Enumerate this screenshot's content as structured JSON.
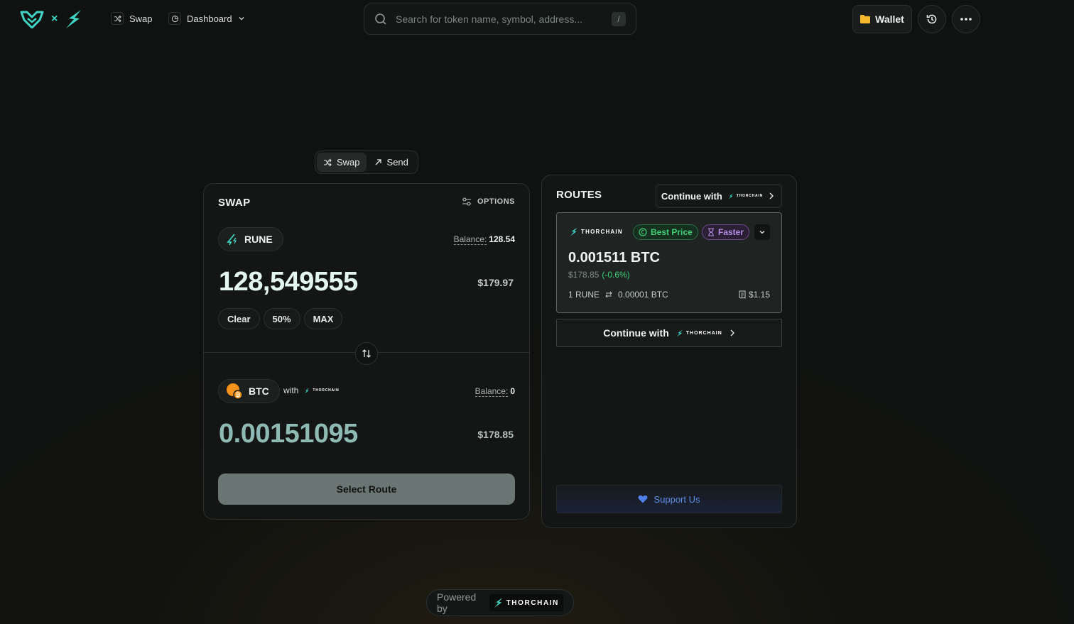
{
  "header": {
    "logo_separator": "×",
    "nav": [
      {
        "label": "Swap"
      },
      {
        "label": "Dashboard"
      }
    ],
    "search": {
      "placeholder": "Search for token name, symbol, address...",
      "shortcut": "/"
    },
    "wallet_label": "Wallet"
  },
  "mode_tabs": [
    {
      "label": "Swap",
      "active": true
    },
    {
      "label": "Send",
      "active": false
    }
  ],
  "swap": {
    "title": "SWAP",
    "options_label": "OPTIONS",
    "from": {
      "token": "RUNE",
      "balance_label": "Balance:",
      "balance_value": "128.54",
      "amount": "128,549555",
      "usd": "$179.97",
      "quick_buttons": [
        "Clear",
        "50%",
        "MAX"
      ]
    },
    "to": {
      "token": "BTC",
      "with_label": "with",
      "provider": "THORCHAIN",
      "balance_label": "Balance:",
      "balance_value": "0",
      "amount": "0.00151095",
      "usd": "$178.85"
    },
    "submit_label": "Select Route"
  },
  "routes": {
    "title": "ROUTES",
    "continue_label": "Continue with",
    "provider": "THORCHAIN",
    "route": {
      "provider": "THORCHAIN",
      "badges": [
        "Best Price",
        "Faster"
      ],
      "amount": "0.001511 BTC",
      "usd": "$178.85",
      "change": "(-0.6%)",
      "rate_from": "1 RUNE",
      "rate_to": "0.00001 BTC",
      "fee": "$1.15"
    },
    "support_label": "Support Us"
  },
  "footer": {
    "powered_by": "Powered by",
    "brand": "THORCHAIN"
  },
  "colors": {
    "accent": "#3fd4c3",
    "best_price": "#3ecf77",
    "faster": "#b58ce0",
    "support": "#5f8de8",
    "btc": "#f7931a"
  }
}
